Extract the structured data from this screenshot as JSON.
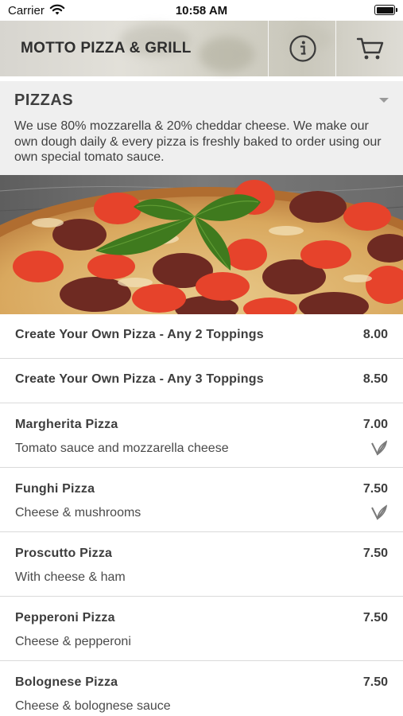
{
  "status_bar": {
    "carrier": "Carrier",
    "time": "10:58 AM"
  },
  "header": {
    "title": "MOTTO PIZZA & GRILL",
    "info_icon": "info-icon",
    "cart_icon": "cart-icon"
  },
  "category": {
    "title": "PIZZAS",
    "description": "We use 80% mozzarella & 20% cheddar cheese. We make our own dough daily & every pizza is freshly baked to order using our own special tomato sauce."
  },
  "items": [
    {
      "name": "Create Your Own Pizza - Any 2 Toppings",
      "price": "8.00",
      "description": "",
      "vegetarian": false
    },
    {
      "name": "Create Your Own Pizza - Any 3 Toppings",
      "price": "8.50",
      "description": "",
      "vegetarian": false
    },
    {
      "name": "Margherita Pizza",
      "price": "7.00",
      "description": "Tomato sauce and mozzarella cheese",
      "vegetarian": true
    },
    {
      "name": "Funghi Pizza",
      "price": "7.50",
      "description": "Cheese & mushrooms",
      "vegetarian": true
    },
    {
      "name": "Proscutto Pizza",
      "price": "7.50",
      "description": "With cheese & ham",
      "vegetarian": false
    },
    {
      "name": "Pepperoni Pizza",
      "price": "7.50",
      "description": "Cheese & pepperoni",
      "vegetarian": false
    },
    {
      "name": "Bolognese Pizza",
      "price": "7.50",
      "description": "Cheese & bolognese sauce",
      "vegetarian": false
    }
  ]
}
